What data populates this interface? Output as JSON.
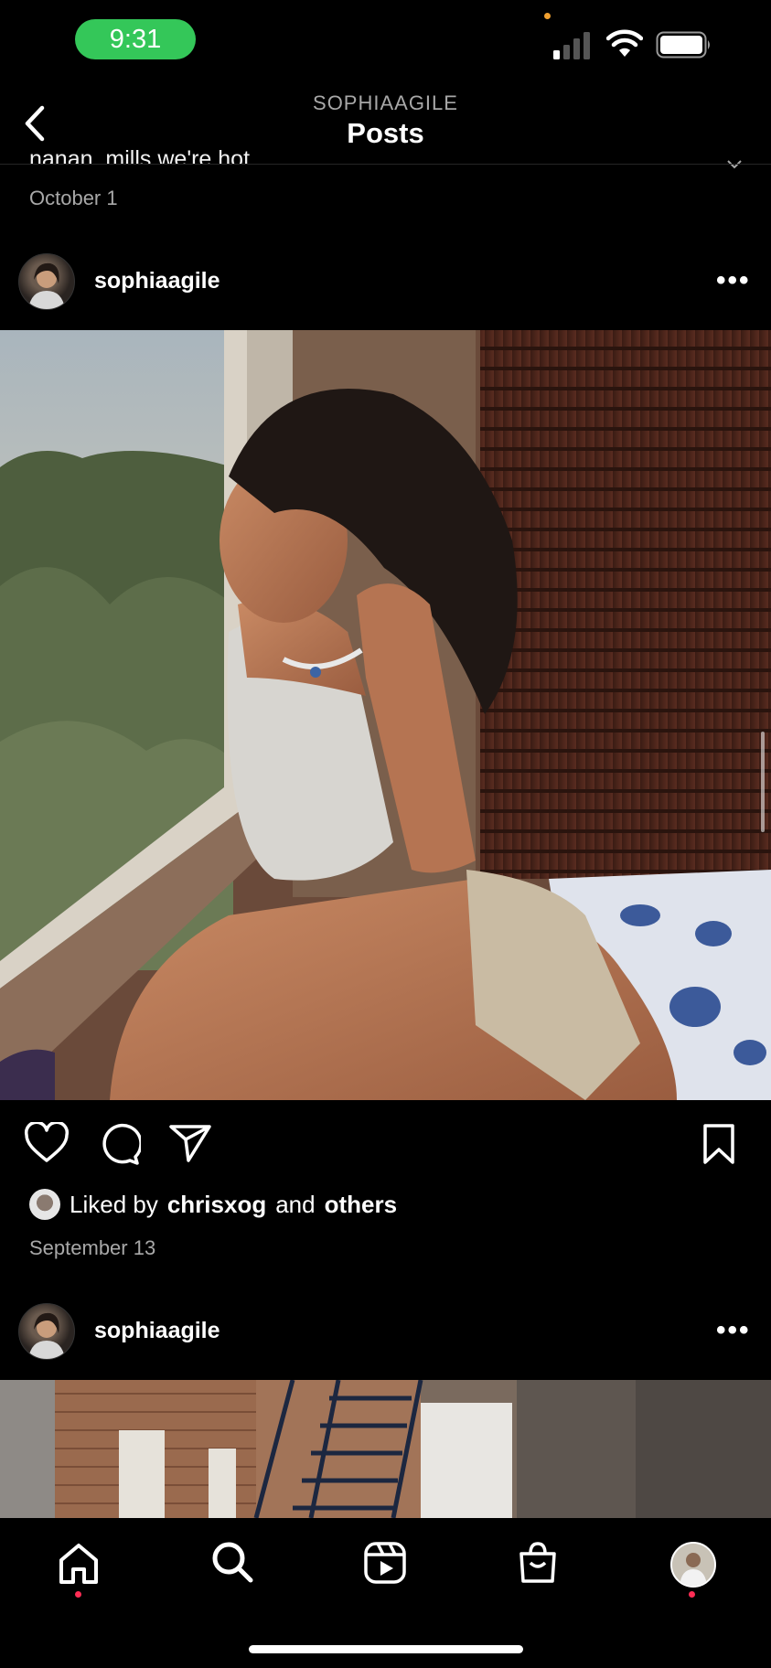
{
  "status_bar": {
    "time": "9:31"
  },
  "header": {
    "username": "SOPHIAAGILE",
    "title": "Posts"
  },
  "previous_post": {
    "cut_text": "nanan_mills we're hot",
    "date": "October 1"
  },
  "post1": {
    "username": "sophiaagile",
    "liked_by_prefix": "Liked by",
    "liked_by_user": "chrisxog",
    "liked_by_and": "and",
    "liked_by_others": "others",
    "date": "September 13"
  },
  "post2": {
    "username": "sophiaagile"
  },
  "icons": {
    "back": "chevron-left-icon",
    "more": "more-horizontal-icon",
    "like": "heart-icon",
    "comment": "comment-icon",
    "share": "send-icon",
    "save": "bookmark-icon",
    "tabs": [
      "home-icon",
      "search-icon",
      "reels-icon",
      "shop-icon",
      "profile-avatar"
    ]
  },
  "colors": {
    "background": "#000000",
    "secondary_text": "#a8a8a8",
    "status_green": "#34c759",
    "notification_red": "#ff2d55"
  }
}
